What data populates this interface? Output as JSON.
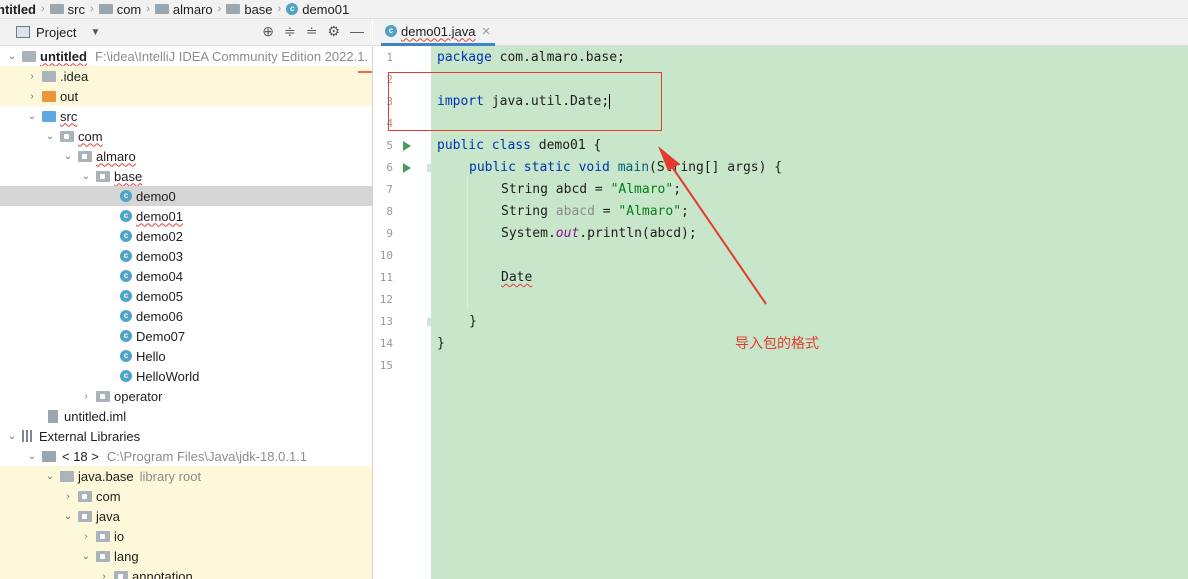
{
  "breadcrumb": {
    "items": [
      "ntitled",
      "src",
      "com",
      "almaro",
      "base",
      "demo01"
    ]
  },
  "project_panel": {
    "title": "Project",
    "tree": [
      {
        "label": "untitled",
        "path": "F:\\idea\\IntelliJ IDEA Community Edition 2022.1."
      },
      {
        "label": ".idea"
      },
      {
        "label": "out"
      },
      {
        "label": "src"
      },
      {
        "label": "com"
      },
      {
        "label": "almaro"
      },
      {
        "label": "base"
      },
      {
        "label": "demo0"
      },
      {
        "label": "demo01"
      },
      {
        "label": "demo02"
      },
      {
        "label": "demo03"
      },
      {
        "label": "demo04"
      },
      {
        "label": "demo05"
      },
      {
        "label": "demo06"
      },
      {
        "label": "Demo07"
      },
      {
        "label": "Hello"
      },
      {
        "label": "HelloWorld"
      },
      {
        "label": "operator"
      },
      {
        "label": "untitled.iml"
      },
      {
        "label": "External Libraries"
      },
      {
        "label": "< 18 >",
        "path": "C:\\Program Files\\Java\\jdk-18.0.1.1"
      },
      {
        "label": "java.base",
        "hint": "library root"
      },
      {
        "label": "com"
      },
      {
        "label": "java"
      },
      {
        "label": "io"
      },
      {
        "label": "lang"
      },
      {
        "label": "annotation"
      }
    ]
  },
  "editor": {
    "tab_label": "demo01.java",
    "line_numbers": [
      "1",
      "2",
      "3",
      "4",
      "5",
      "6",
      "7",
      "8",
      "9",
      "10",
      "11",
      "12",
      "13",
      "14",
      "15"
    ],
    "code": {
      "l1_kw": "package",
      "l1_rest": " com.almaro.base;",
      "l3_kw": "import",
      "l3_rest": " java.util.Date;",
      "l5_kw": "public class",
      "l5_rest": " demo01 {",
      "l6_kw": "public static void",
      "l6_fn": "main",
      "l6_rest": "(String[] args) {",
      "l7_a": "String abcd = ",
      "l7_s": "\"Almaro\"",
      "l7_b": ";",
      "l8_a": "String ",
      "l8_var": "abacd",
      "l8_b": " = ",
      "l8_s": "\"Almaro\"",
      "l8_c": ";",
      "l9_a": "System.",
      "l9_out": "out",
      "l9_b": ".println(abcd);",
      "l11": "Date",
      "l13": "}",
      "l14": "}"
    }
  },
  "annotation": {
    "text": "导入包的格式",
    "color": "#e53b2f"
  }
}
